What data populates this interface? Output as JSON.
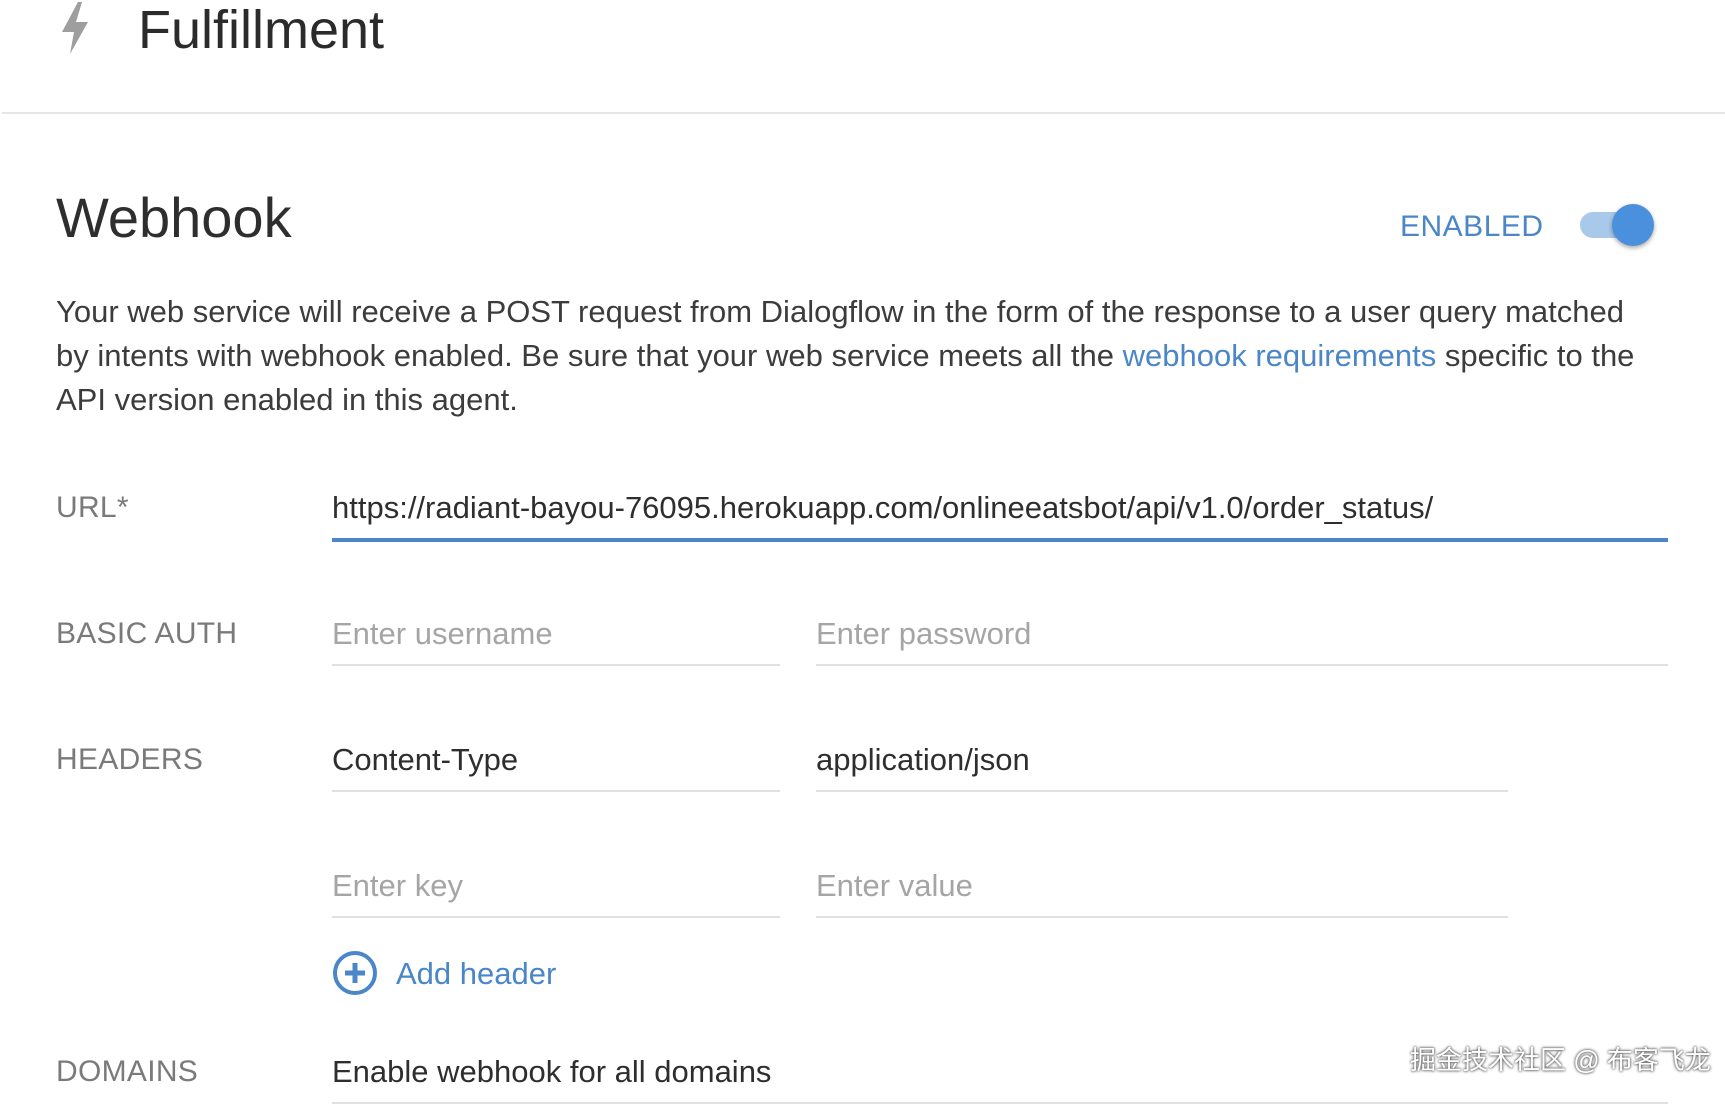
{
  "header": {
    "title": "Fulfillment",
    "icon": "bolt-icon"
  },
  "webhook": {
    "title": "Webhook",
    "status_label": "ENABLED",
    "enabled": true,
    "description_before_link": "Your web service will receive a POST request from Dialogflow in the form of the response to a user query matched by intents with webhook enabled. Be sure that your web service meets all the ",
    "description_link": "webhook requirements",
    "description_after_link": " specific to the API version enabled in this agent."
  },
  "url": {
    "label": "URL*",
    "value": "https://radiant-bayou-76095.herokuapp.com/onlineeatsbot/api/v1.0/order_status/"
  },
  "basic_auth": {
    "label": "BASIC AUTH",
    "username_placeholder": "Enter username",
    "password_placeholder": "Enter password"
  },
  "headers": {
    "label": "HEADERS",
    "rows": [
      {
        "key": "Content-Type",
        "value": "application/json"
      }
    ],
    "key_placeholder": "Enter key",
    "value_placeholder": "Enter value",
    "add_label": "Add header"
  },
  "domains": {
    "label": "DOMAINS",
    "value": "Enable webhook for all domains"
  },
  "watermark": "掘金技术社区 @ 布客飞龙",
  "colors": {
    "accent": "#4a86c8",
    "toggle_track": "#a9c9ea",
    "divider": "#e6e6e6"
  }
}
